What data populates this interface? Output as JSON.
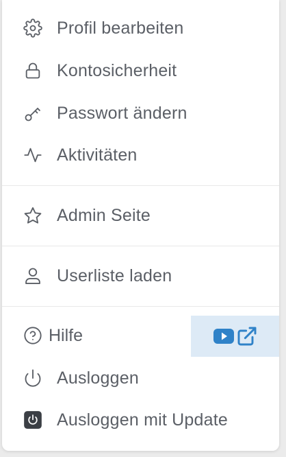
{
  "menu": {
    "items": [
      {
        "label": "Profil bearbeiten",
        "icon": "gear-icon"
      },
      {
        "label": "Kontosicherheit",
        "icon": "lock-icon"
      },
      {
        "label": "Passwort ändern",
        "icon": "key-icon"
      },
      {
        "label": "Aktivitäten",
        "icon": "activity-icon"
      }
    ],
    "admin": {
      "label": "Admin Seite",
      "icon": "star-icon"
    },
    "userlist": {
      "label": "Userliste laden",
      "icon": "user-icon"
    },
    "help": {
      "label": "Hilfe",
      "icon": "help-circle-icon"
    },
    "help_video": {
      "icons": [
        "youtube-icon",
        "external-link-icon"
      ]
    },
    "logout": {
      "label": "Ausloggen",
      "icon": "power-icon"
    },
    "logout_update": {
      "label": "Ausloggen mit Update",
      "icon": "power-square-icon"
    }
  },
  "colors": {
    "text": "#5b5f66",
    "icon_stroke": "#5b5f66",
    "accent_blue": "#2f82c8",
    "highlight_bg": "#ddeaf6",
    "divider": "#e8e8e8"
  }
}
